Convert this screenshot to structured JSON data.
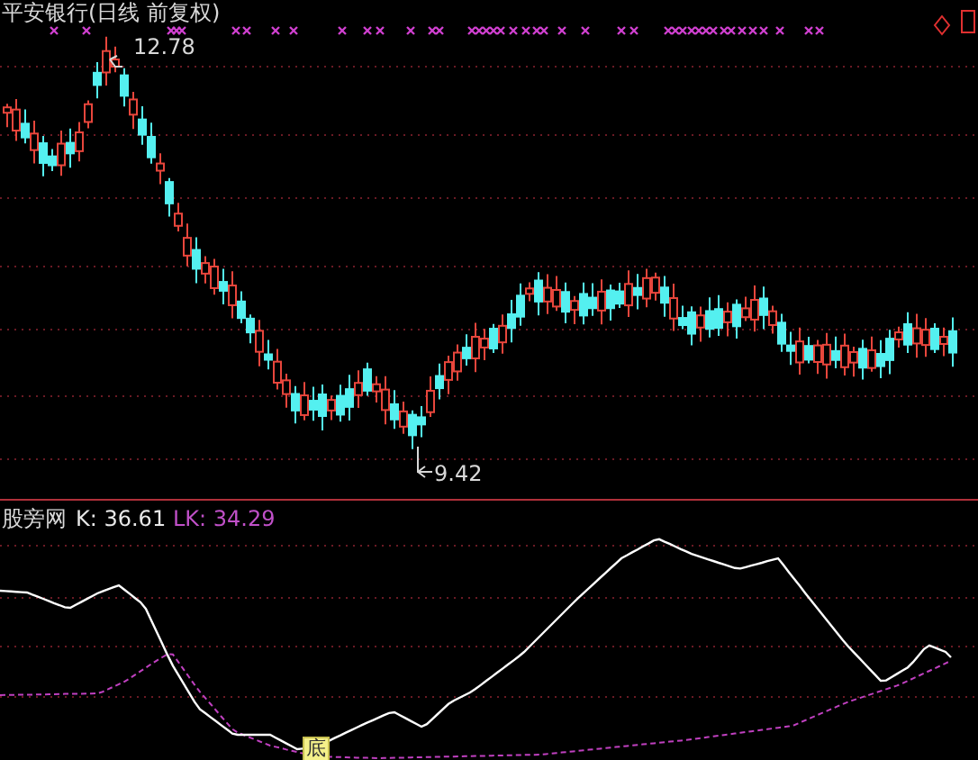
{
  "price_panel": {
    "title": "平安银行(日线 前复权)",
    "high_label": "12.78",
    "low_label": "9.42"
  },
  "indicator_panel": {
    "name": "股旁网",
    "k_reading": "K: 36.61",
    "lk_reading": "LK: 34.29",
    "bottom_signal": "底"
  }
}
